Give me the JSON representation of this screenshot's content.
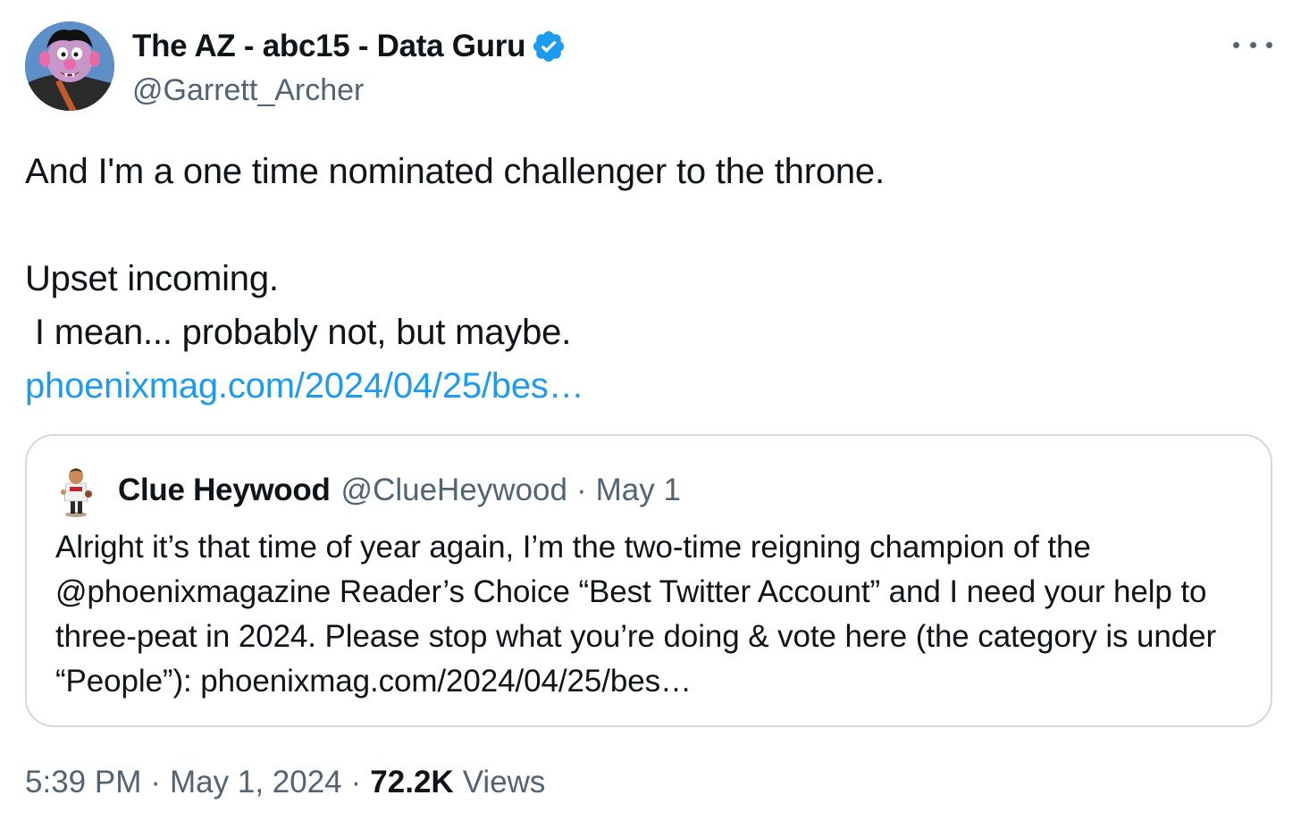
{
  "tweet": {
    "author": {
      "name": "The AZ - abc15 - Data Guru",
      "handle": "@Garrett_Archer",
      "verified": true
    },
    "text_lines": [
      "And I'm a one time nominated challenger to the throne.",
      "",
      "Upset incoming.",
      " I mean... probably not, but maybe."
    ],
    "link": "phoenixmag.com/2024/04/25/bes…",
    "quoted": {
      "name": "Clue Heywood",
      "handle": "@ClueHeywood",
      "separator": "·",
      "date": "May 1",
      "text": "Alright it’s that time of year again, I’m the two-time reigning champion of the @phoenixmagazine Reader’s Choice “Best Twitter Account” and I need your help to three-peat in 2024. Please stop what you’re doing & vote here (the category is under “People”): phoenixmag.com/2024/04/25/bes…"
    },
    "footer": {
      "time": "5:39 PM",
      "separator": "·",
      "date": "May 1, 2024",
      "views_count": "72.2K",
      "views_label": "Views"
    }
  },
  "colors": {
    "text": "#0f1419",
    "secondary": "#536471",
    "link": "#1d9bf0",
    "verified": "#1d9bf0",
    "border": "#cfd9de"
  },
  "icons": {
    "verified": "verified-badge-icon",
    "more": "more-horizontal-icon"
  }
}
